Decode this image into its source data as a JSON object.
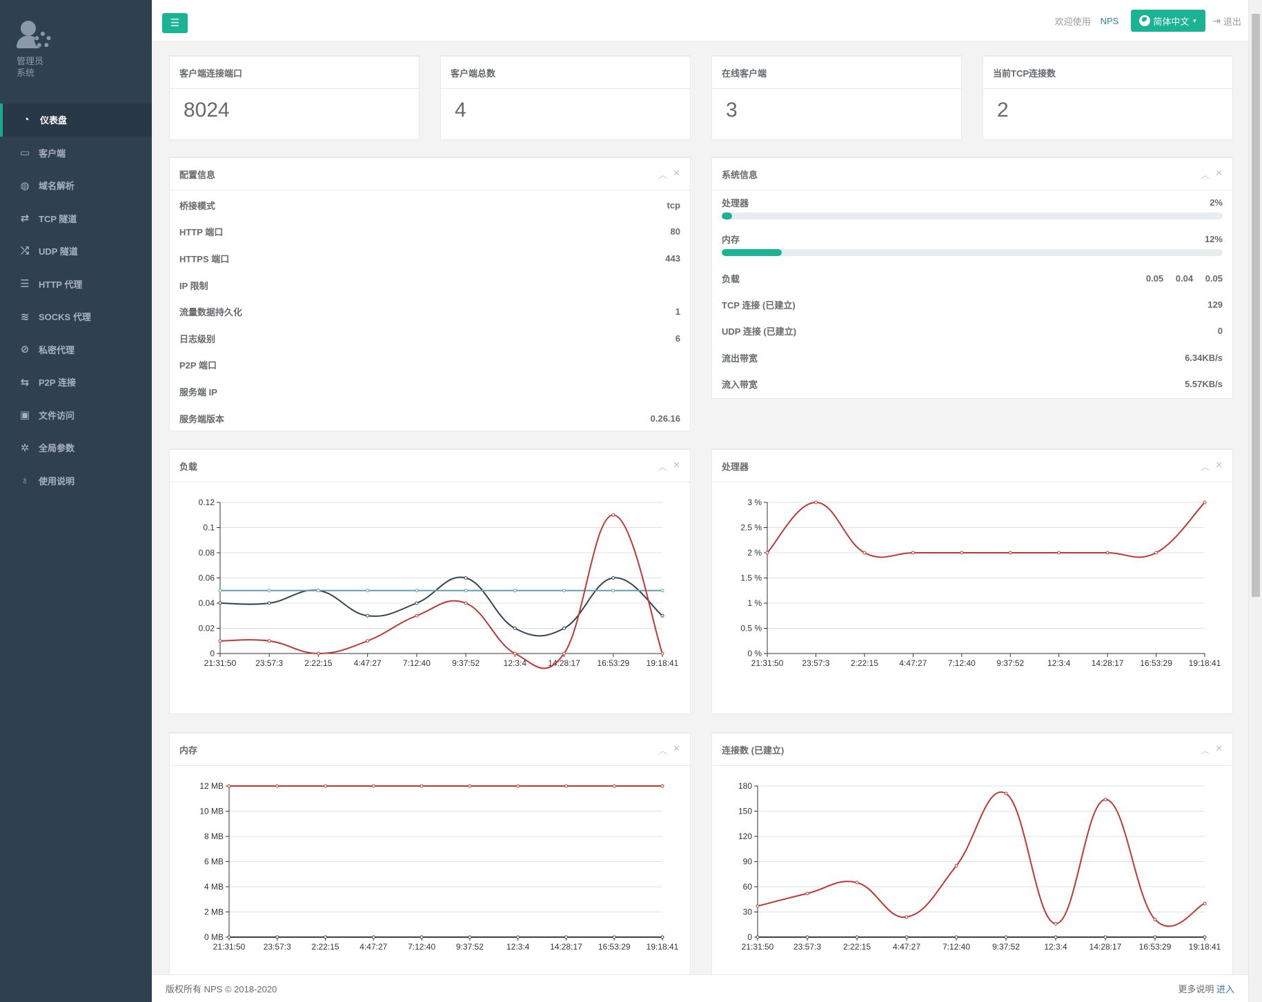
{
  "profile": {
    "role_line1": "管理员",
    "role_line2": "系统"
  },
  "sidebar": {
    "items": [
      {
        "label": "仪表盘",
        "icon": "dashboard-icon",
        "glyph": "◔",
        "active": true
      },
      {
        "label": "客户端",
        "icon": "monitor-icon",
        "glyph": "▭"
      },
      {
        "label": "域名解析",
        "icon": "globe-icon",
        "glyph": "◍"
      },
      {
        "label": "TCP 隧道",
        "icon": "retweet-icon",
        "glyph": "⇄"
      },
      {
        "label": "UDP 隧道",
        "icon": "random-icon",
        "glyph": "⤮"
      },
      {
        "label": "HTTP 代理",
        "icon": "server-icon",
        "glyph": "☰"
      },
      {
        "label": "SOCKS 代理",
        "icon": "layers-icon",
        "glyph": "≋"
      },
      {
        "label": "私密代理",
        "icon": "eye-slash-icon",
        "glyph": "⊘"
      },
      {
        "label": "P2P 连接",
        "icon": "exchange-icon",
        "glyph": "⇆"
      },
      {
        "label": "文件访问",
        "icon": "briefcase-icon",
        "glyph": "▣"
      },
      {
        "label": "全局参数",
        "icon": "gear-icon",
        "glyph": "✲"
      },
      {
        "label": "使用说明",
        "icon": "lightbulb-icon",
        "glyph": "♁"
      }
    ]
  },
  "topbar": {
    "menu_icon": "☰",
    "welcome": "欢迎使用",
    "brand": "NPS",
    "language": "简体中文",
    "logout": "退出"
  },
  "stats": [
    {
      "title": "客户端连接端口",
      "value": "8024"
    },
    {
      "title": "客户端总数",
      "value": "4"
    },
    {
      "title": "在线客户端",
      "value": "3"
    },
    {
      "title": "当前TCP连接数",
      "value": "2"
    }
  ],
  "config": {
    "title": "配置信息",
    "rows": [
      {
        "label": "桥接模式",
        "value": "tcp"
      },
      {
        "label": "HTTP 端口",
        "value": "80"
      },
      {
        "label": "HTTPS 端口",
        "value": "443"
      },
      {
        "label": "IP 限制",
        "value": ""
      },
      {
        "label": "流量数据持久化",
        "value": "1"
      },
      {
        "label": "日志级别",
        "value": "6"
      },
      {
        "label": "P2P 端口",
        "value": ""
      },
      {
        "label": "服务端 IP",
        "value": ""
      },
      {
        "label": "服务端版本",
        "value": "0.26.16"
      }
    ]
  },
  "system": {
    "title": "系统信息",
    "cpu_label": "处理器",
    "cpu_value": "2%",
    "cpu_fraction": 0.02,
    "mem_label": "内存",
    "mem_value": "12%",
    "mem_fraction": 0.12,
    "load_label": "负载",
    "load_values": [
      "0.05",
      "0.04",
      "0.05"
    ],
    "rows": [
      {
        "label": "TCP 连接 (已建立)",
        "value": "129"
      },
      {
        "label": "UDP 连接 (已建立)",
        "value": "0"
      },
      {
        "label": "流出带宽",
        "value": "6.34KB/s"
      },
      {
        "label": "流入带宽",
        "value": "5.57KB/s"
      }
    ]
  },
  "charts": {
    "load_title": "负载",
    "cpu_title": "处理器",
    "mem_title": "内存",
    "conn_title": "连接数 (已建立)"
  },
  "chart_data": [
    {
      "type": "line",
      "title": "负载",
      "categories": [
        "21:31:50",
        "23:57:3",
        "2:22:15",
        "4:47:27",
        "7:12:40",
        "9:37:52",
        "12:3:4",
        "14:28:17",
        "16:53:29",
        "19:18:41"
      ],
      "ylim": [
        0,
        0.12
      ],
      "yticks": [
        "0",
        "0.02",
        "0.04",
        "0.06",
        "0.08",
        "0.1",
        "0.12"
      ],
      "series": [
        {
          "color": "#2f4554",
          "values": [
            0.04,
            0.04,
            0.05,
            0.03,
            0.04,
            0.06,
            0.02,
            0.02,
            0.06,
            0.03
          ]
        },
        {
          "color": "#61a0a8",
          "values": [
            0.05,
            0.05,
            0.05,
            0.05,
            0.05,
            0.05,
            0.05,
            0.05,
            0.05,
            0.05
          ]
        },
        {
          "color": "#c23531",
          "values": [
            0.01,
            0.01,
            0,
            0.01,
            0.03,
            0.04,
            0,
            0,
            0.11,
            0
          ]
        }
      ]
    },
    {
      "type": "line",
      "title": "处理器",
      "categories": [
        "21:31:50",
        "23:57:3",
        "2:22:15",
        "4:47:27",
        "7:12:40",
        "9:37:52",
        "12:3:4",
        "14:28:17",
        "16:53:29",
        "19:18:41"
      ],
      "ylim": [
        0,
        3
      ],
      "yticks": [
        "0 %",
        "0.5 %",
        "1 %",
        "1.5 %",
        "2 %",
        "2.5 %",
        "3 %"
      ],
      "series": [
        {
          "color": "#c23531",
          "values": [
            2,
            3,
            2,
            2,
            2,
            2,
            2,
            2,
            2,
            3
          ]
        }
      ]
    },
    {
      "type": "line",
      "title": "内存",
      "categories": [
        "21:31:50",
        "23:57:3",
        "2:22:15",
        "4:47:27",
        "7:12:40",
        "9:37:52",
        "12:3:4",
        "14:28:17",
        "16:53:29",
        "19:18:41"
      ],
      "ylim": [
        0,
        12
      ],
      "yticks": [
        "0 MB",
        "2 MB",
        "4 MB",
        "6 MB",
        "8 MB",
        "10 MB",
        "12 MB"
      ],
      "series": [
        {
          "color": "#c23531",
          "values": [
            12,
            12,
            12,
            12,
            12,
            12,
            12,
            12,
            12,
            12
          ]
        },
        {
          "color": "#2f4554",
          "values": [
            0,
            0,
            0,
            0,
            0,
            0,
            0,
            0,
            0,
            0
          ]
        }
      ]
    },
    {
      "type": "line",
      "title": "连接数 (已建立)",
      "categories": [
        "21:31:50",
        "23:57:3",
        "2:22:15",
        "4:47:27",
        "7:12:40",
        "9:37:52",
        "12:3:4",
        "14:28:17",
        "16:53:29",
        "19:18:41"
      ],
      "ylim": [
        0,
        180
      ],
      "yticks": [
        "0",
        "30",
        "60",
        "90",
        "120",
        "150",
        "180"
      ],
      "series": [
        {
          "color": "#c23531",
          "values": [
            37,
            52,
            65,
            24,
            85,
            171,
            16,
            164,
            21,
            40
          ]
        },
        {
          "color": "#2f4554",
          "values": [
            0,
            0,
            0,
            0,
            0,
            0,
            0,
            0,
            0,
            0
          ]
        }
      ]
    }
  ],
  "footer": {
    "copyright": "版权所有 NPS © 2018-2020",
    "more_text": "更多说明",
    "more_link": "进入"
  }
}
